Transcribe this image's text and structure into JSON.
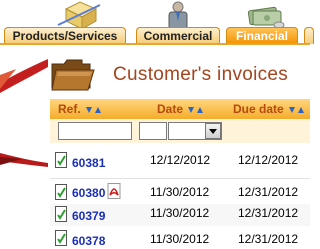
{
  "tabs": [
    {
      "label": "Products/Services",
      "icon": "box-icon"
    },
    {
      "label": "Commercial",
      "icon": "businessman-icon"
    },
    {
      "label": "Financial",
      "icon": "money-icon",
      "active": true
    }
  ],
  "page": {
    "title": "Customer's invoices"
  },
  "table": {
    "columns": [
      "Ref.",
      "Date",
      "Due date"
    ],
    "rows": [
      {
        "ref": "60381",
        "date": "12/12/2012",
        "due_date": "12/12/2012",
        "pdf": false
      },
      {
        "ref": "60380",
        "date": "11/30/2012",
        "due_date": "12/31/2012",
        "pdf": true
      },
      {
        "ref": "60379",
        "date": "11/30/2012",
        "due_date": "12/31/2012",
        "pdf": false
      },
      {
        "ref": "60378",
        "date": "11/30/2012",
        "due_date": "12/31/2012",
        "pdf": false
      }
    ]
  },
  "colors": {
    "accent": "#f29200",
    "title": "#a5441c",
    "link": "#1a2fb5"
  }
}
